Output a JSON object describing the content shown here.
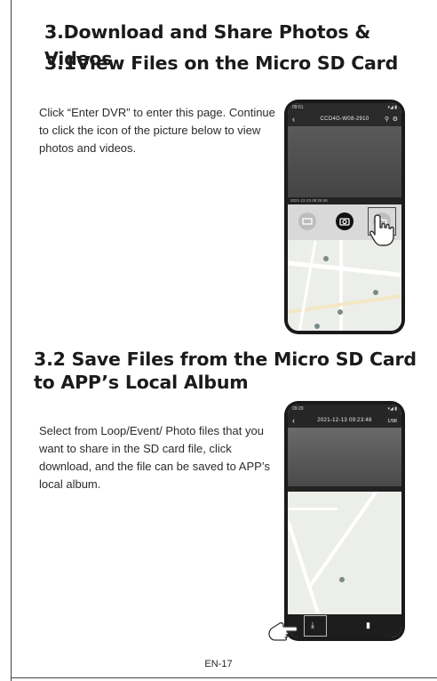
{
  "heading": {
    "section": "3.Download and Share Photos & Videos",
    "sub1": "3.1View Files on the Micro SD Card",
    "sub2": "3.2 Save Files from the Micro SD Card to APP’s Local Album"
  },
  "paragraphs": {
    "p1": "Click “Enter DVR” to enter this page. Continue to click the icon of the picture below to view photos and videos.",
    "p2": "Select from Loop/Event/ Photo files that you want to share in the SD card file, click download, and the file can be saved to APP’s local album."
  },
  "phone1": {
    "time": "09:51",
    "device": "CCD4G-W08-2910",
    "timestamp": "2021-12-23 09:28:48",
    "icons": [
      "film-icon",
      "camera-icon",
      "folder-icon"
    ]
  },
  "phone2": {
    "time": "09:29",
    "header": "2021-12-13 09:23:48",
    "counter": "1/98",
    "icons": [
      "download-icon",
      "trash-icon"
    ]
  },
  "footer": {
    "page": "EN-17"
  },
  "colors": {
    "frame": "#1a1a1a",
    "map": "#eceeea",
    "control_bar": "#d9d9d9"
  }
}
